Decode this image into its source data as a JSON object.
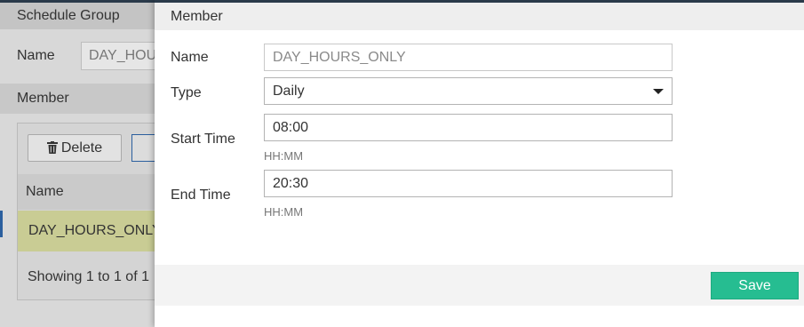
{
  "background_page": {
    "section_title": "Schedule Group",
    "name_label": "Name",
    "name_value": "DAY_HOURS_ONLY",
    "member_header": "Member",
    "delete_label": "Delete",
    "table_header_name": "Name",
    "selected_row_name": "DAY_HOURS_ONLY",
    "showing_text": "Showing 1 to 1 of 1"
  },
  "dialog": {
    "title": "Member",
    "fields": {
      "name": {
        "label": "Name",
        "value": "DAY_HOURS_ONLY"
      },
      "type": {
        "label": "Type",
        "value": "Daily"
      },
      "start_time": {
        "label": "Start Time",
        "value": "08:00",
        "hint": "HH:MM"
      },
      "end_time": {
        "label": "End Time",
        "value": "20:30",
        "hint": "HH:MM"
      }
    },
    "save_label": "Save"
  },
  "colors": {
    "save_button": "#26bd91",
    "selected_row": "#c9cc94",
    "top_bar": "#2a3a4a"
  },
  "icons": {
    "delete": "trash-icon",
    "type_dropdown": "caret-down-icon"
  }
}
